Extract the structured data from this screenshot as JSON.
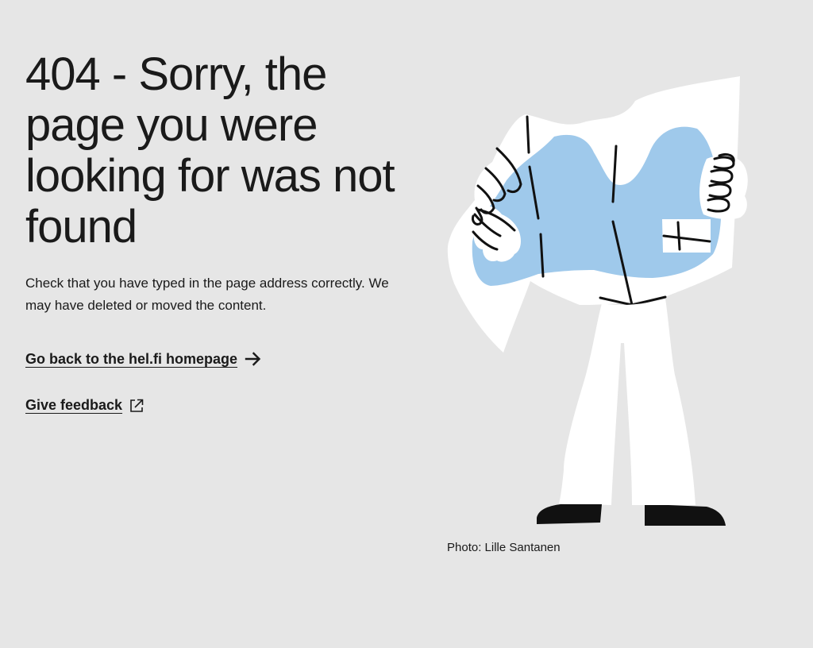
{
  "error": {
    "title": "404 - Sorry, the page you were looking for was not found",
    "description": "Check that you have typed in the page address correctly. We may have deleted or moved the content."
  },
  "links": {
    "home_label": "Go back to the hel.fi homepage",
    "home_icon": "arrow-right-icon",
    "feedback_label": "Give feedback",
    "feedback_icon": "external-link-icon"
  },
  "illustration": {
    "name": "person-reading-map-illustration",
    "credit": "Photo: Lille Santanen",
    "colors": {
      "map": "#9fc9eb",
      "paper": "#ffffff",
      "ink": "#111111"
    }
  }
}
